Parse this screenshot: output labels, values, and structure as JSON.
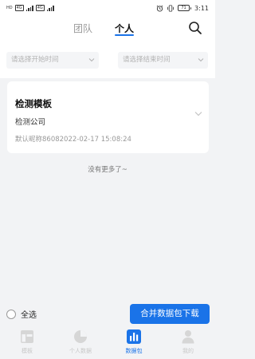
{
  "status_bar": {
    "carrier_badge": "HD",
    "network_1": "4G",
    "network_2": "4G",
    "battery": "71",
    "time": "3:11"
  },
  "header": {
    "tabs": [
      {
        "label": "团队",
        "active": false
      },
      {
        "label": "个人",
        "active": true
      }
    ],
    "search_icon": "search-icon",
    "accent_color": "#1a73e8"
  },
  "filters": {
    "start_placeholder": "请选择开始时间",
    "end_placeholder": "请选择结束时间"
  },
  "records": [
    {
      "title": "检测模板",
      "company": "检测公司",
      "meta": "默认昵称86082022-02-17 15:08:24"
    }
  ],
  "list_end_text": "没有更多了~",
  "actions": {
    "select_all_label": "全选",
    "merge_button_label": "合并数据包下载"
  },
  "nav": {
    "items": [
      {
        "label": "模板",
        "icon": "template-icon",
        "active": false
      },
      {
        "label": "个人数据",
        "icon": "pie-chart-icon",
        "active": false
      },
      {
        "label": "数据包",
        "icon": "bar-chart-icon",
        "active": true
      },
      {
        "label": "我的",
        "icon": "user-icon",
        "active": false
      }
    ]
  }
}
